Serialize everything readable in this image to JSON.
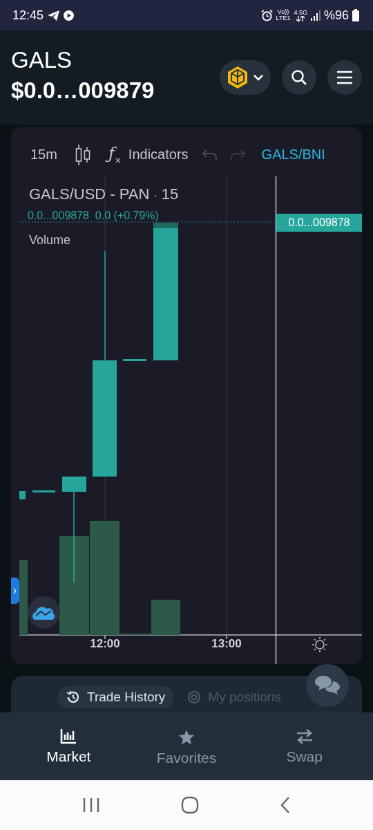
{
  "status_bar": {
    "time": "12:45",
    "volte": "Vo))",
    "lte": "LTE1",
    "network": "4.5G",
    "battery": "%96"
  },
  "header": {
    "title": "GALS",
    "price": "$0.0…009879"
  },
  "toolbar": {
    "interval": "15m",
    "indicators_icon": "ƒ$_{×}$",
    "indicators": "Indicators",
    "pair": "GALS/BNI"
  },
  "chart": {
    "symbol": "GALS/USD - PAN",
    "separator": "·",
    "interval": "15",
    "last": "0.0...009878",
    "change": "0.0 (+0.79%)",
    "volume_label": "Volume",
    "price_label": "0.0...009878",
    "x_labels": [
      "12:00",
      "13:00"
    ]
  },
  "panel_tabs": [
    {
      "label": "Trade History",
      "selected": true
    },
    {
      "label": "My positions",
      "selected": false
    }
  ],
  "nav": [
    {
      "label": "Market",
      "selected": true
    },
    {
      "label": "Favorites",
      "selected": false
    },
    {
      "label": "Swap",
      "selected": false
    }
  ]
}
